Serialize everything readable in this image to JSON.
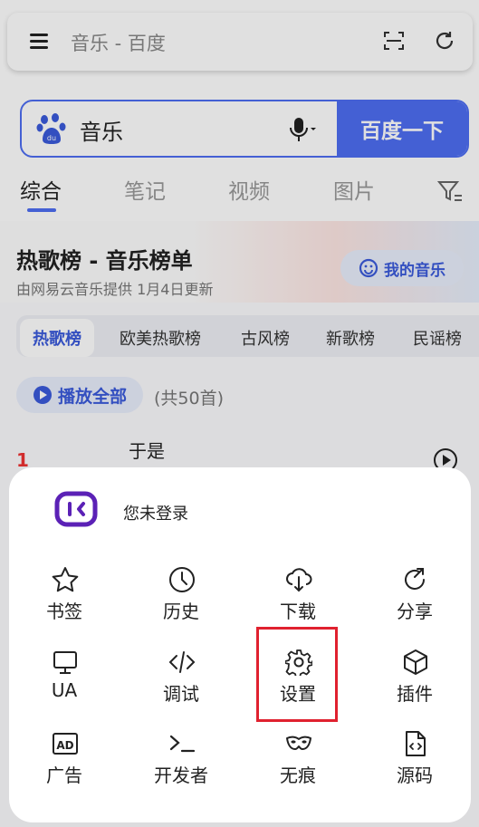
{
  "address_bar": {
    "text": "音乐 - 百度"
  },
  "search": {
    "query": "音乐",
    "button_label": "百度一下"
  },
  "tabs": [
    {
      "label": "综合",
      "active": true
    },
    {
      "label": "笔记"
    },
    {
      "label": "视频"
    },
    {
      "label": "图片"
    }
  ],
  "chart": {
    "title": "热歌榜 - 音乐榜单",
    "subtitle": "由网易云音乐提供 1月4日更新",
    "my_music_label": "我的音乐",
    "categories": [
      "热歌榜",
      "欧美热歌榜",
      "古风榜",
      "新歌榜",
      "民谣榜"
    ],
    "play_all_label": "播放全部",
    "count_label": "(共50首)",
    "first_rank": "1",
    "first_song": "于是"
  },
  "menu": {
    "login_text": "您未登录",
    "items": [
      {
        "label": "书签",
        "icon": "star-icon"
      },
      {
        "label": "历史",
        "icon": "clock-icon"
      },
      {
        "label": "下载",
        "icon": "cloud-download-icon"
      },
      {
        "label": "分享",
        "icon": "share-icon"
      },
      {
        "label": "UA",
        "icon": "monitor-icon"
      },
      {
        "label": "调试",
        "icon": "code-icon"
      },
      {
        "label": "设置",
        "icon": "gear-icon",
        "highlighted": true
      },
      {
        "label": "插件",
        "icon": "cube-icon"
      },
      {
        "label": "广告",
        "icon": "ad-icon"
      },
      {
        "label": "开发者",
        "icon": "terminal-icon"
      },
      {
        "label": "无痕",
        "icon": "mask-icon"
      },
      {
        "label": "源码",
        "icon": "source-file-icon"
      }
    ]
  },
  "colors": {
    "accent": "#4e6ef2",
    "highlight": "#e0212f",
    "rank": "#e33333"
  }
}
